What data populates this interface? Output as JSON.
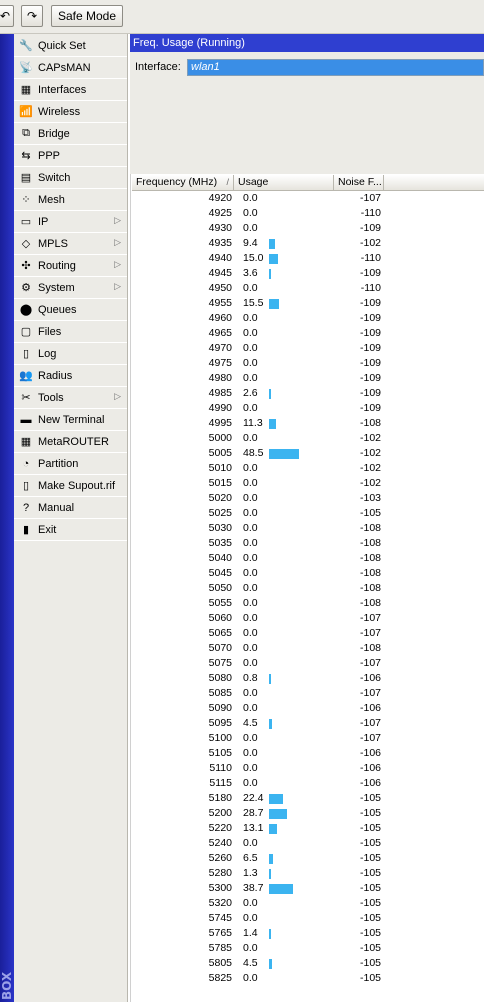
{
  "toolbar": {
    "undo_glyph": "↶",
    "redo_glyph": "↷",
    "safe_mode_label": "Safe Mode"
  },
  "brand_text": "BOX",
  "sidebar": {
    "items": [
      {
        "label": "Quick Set",
        "icon": "quick-set-icon",
        "glyph": "🔧",
        "submenu": false
      },
      {
        "label": "CAPsMAN",
        "icon": "capsman-icon",
        "glyph": "📡",
        "submenu": false
      },
      {
        "label": "Interfaces",
        "icon": "interfaces-icon",
        "glyph": "▦",
        "submenu": false
      },
      {
        "label": "Wireless",
        "icon": "wireless-icon",
        "glyph": "📶",
        "submenu": false
      },
      {
        "label": "Bridge",
        "icon": "bridge-icon",
        "glyph": "⧉",
        "submenu": false
      },
      {
        "label": "PPP",
        "icon": "ppp-icon",
        "glyph": "⇆",
        "submenu": false
      },
      {
        "label": "Switch",
        "icon": "switch-icon",
        "glyph": "▤",
        "submenu": false
      },
      {
        "label": "Mesh",
        "icon": "mesh-icon",
        "glyph": "⁘",
        "submenu": false
      },
      {
        "label": "IP",
        "icon": "ip-icon",
        "glyph": "▭",
        "submenu": true
      },
      {
        "label": "MPLS",
        "icon": "mpls-icon",
        "glyph": "◇",
        "submenu": true
      },
      {
        "label": "Routing",
        "icon": "routing-icon",
        "glyph": "✣",
        "submenu": true
      },
      {
        "label": "System",
        "icon": "system-icon",
        "glyph": "⚙",
        "submenu": true
      },
      {
        "label": "Queues",
        "icon": "queues-icon",
        "glyph": "⬤",
        "submenu": false
      },
      {
        "label": "Files",
        "icon": "files-icon",
        "glyph": "▢",
        "submenu": false
      },
      {
        "label": "Log",
        "icon": "log-icon",
        "glyph": "▯",
        "submenu": false
      },
      {
        "label": "Radius",
        "icon": "radius-icon",
        "glyph": "👥",
        "submenu": false
      },
      {
        "label": "Tools",
        "icon": "tools-icon",
        "glyph": "✂",
        "submenu": true
      },
      {
        "label": "New Terminal",
        "icon": "terminal-icon",
        "glyph": "▬",
        "submenu": false
      },
      {
        "label": "MetaROUTER",
        "icon": "metarouter-icon",
        "glyph": "▦",
        "submenu": false
      },
      {
        "label": "Partition",
        "icon": "partition-icon",
        "glyph": "◔",
        "submenu": false
      },
      {
        "label": "Make Supout.rif",
        "icon": "supout-icon",
        "glyph": "▯",
        "submenu": false
      },
      {
        "label": "Manual",
        "icon": "manual-icon",
        "glyph": "?",
        "submenu": false
      },
      {
        "label": "Exit",
        "icon": "exit-icon",
        "glyph": "▮",
        "submenu": false
      }
    ],
    "submenu_arrow": "▷"
  },
  "panel": {
    "title": "Freq. Usage (Running)",
    "interface_label": "Interface:",
    "interface_value": "wlan1"
  },
  "table": {
    "columns": [
      "Frequency (MHz)",
      "Usage",
      "Noise F..."
    ],
    "sort_glyph": "/",
    "usage_bar_color": "#3bb4f0",
    "rows": [
      {
        "freq": "4920",
        "usage": "0.0",
        "noise": "-107"
      },
      {
        "freq": "4925",
        "usage": "0.0",
        "noise": "-110"
      },
      {
        "freq": "4930",
        "usage": "0.0",
        "noise": "-109"
      },
      {
        "freq": "4935",
        "usage": "9.4",
        "noise": "-102"
      },
      {
        "freq": "4940",
        "usage": "15.0",
        "noise": "-110"
      },
      {
        "freq": "4945",
        "usage": "3.6",
        "noise": "-109"
      },
      {
        "freq": "4950",
        "usage": "0.0",
        "noise": "-110"
      },
      {
        "freq": "4955",
        "usage": "15.5",
        "noise": "-109"
      },
      {
        "freq": "4960",
        "usage": "0.0",
        "noise": "-109"
      },
      {
        "freq": "4965",
        "usage": "0.0",
        "noise": "-109"
      },
      {
        "freq": "4970",
        "usage": "0.0",
        "noise": "-109"
      },
      {
        "freq": "4975",
        "usage": "0.0",
        "noise": "-109"
      },
      {
        "freq": "4980",
        "usage": "0.0",
        "noise": "-109"
      },
      {
        "freq": "4985",
        "usage": "2.6",
        "noise": "-109"
      },
      {
        "freq": "4990",
        "usage": "0.0",
        "noise": "-109"
      },
      {
        "freq": "4995",
        "usage": "11.3",
        "noise": "-108"
      },
      {
        "freq": "5000",
        "usage": "0.0",
        "noise": "-102"
      },
      {
        "freq": "5005",
        "usage": "48.5",
        "noise": "-102"
      },
      {
        "freq": "5010",
        "usage": "0.0",
        "noise": "-102"
      },
      {
        "freq": "5015",
        "usage": "0.0",
        "noise": "-102"
      },
      {
        "freq": "5020",
        "usage": "0.0",
        "noise": "-103"
      },
      {
        "freq": "5025",
        "usage": "0.0",
        "noise": "-105"
      },
      {
        "freq": "5030",
        "usage": "0.0",
        "noise": "-108"
      },
      {
        "freq": "5035",
        "usage": "0.0",
        "noise": "-108"
      },
      {
        "freq": "5040",
        "usage": "0.0",
        "noise": "-108"
      },
      {
        "freq": "5045",
        "usage": "0.0",
        "noise": "-108"
      },
      {
        "freq": "5050",
        "usage": "0.0",
        "noise": "-108"
      },
      {
        "freq": "5055",
        "usage": "0.0",
        "noise": "-108"
      },
      {
        "freq": "5060",
        "usage": "0.0",
        "noise": "-107"
      },
      {
        "freq": "5065",
        "usage": "0.0",
        "noise": "-107"
      },
      {
        "freq": "5070",
        "usage": "0.0",
        "noise": "-108"
      },
      {
        "freq": "5075",
        "usage": "0.0",
        "noise": "-107"
      },
      {
        "freq": "5080",
        "usage": "0.8",
        "noise": "-106"
      },
      {
        "freq": "5085",
        "usage": "0.0",
        "noise": "-107"
      },
      {
        "freq": "5090",
        "usage": "0.0",
        "noise": "-106"
      },
      {
        "freq": "5095",
        "usage": "4.5",
        "noise": "-107"
      },
      {
        "freq": "5100",
        "usage": "0.0",
        "noise": "-107"
      },
      {
        "freq": "5105",
        "usage": "0.0",
        "noise": "-106"
      },
      {
        "freq": "5110",
        "usage": "0.0",
        "noise": "-106"
      },
      {
        "freq": "5115",
        "usage": "0.0",
        "noise": "-106"
      },
      {
        "freq": "5180",
        "usage": "22.4",
        "noise": "-105"
      },
      {
        "freq": "5200",
        "usage": "28.7",
        "noise": "-105"
      },
      {
        "freq": "5220",
        "usage": "13.1",
        "noise": "-105"
      },
      {
        "freq": "5240",
        "usage": "0.0",
        "noise": "-105"
      },
      {
        "freq": "5260",
        "usage": "6.5",
        "noise": "-105"
      },
      {
        "freq": "5280",
        "usage": "1.3",
        "noise": "-105"
      },
      {
        "freq": "5300",
        "usage": "38.7",
        "noise": "-105"
      },
      {
        "freq": "5320",
        "usage": "0.0",
        "noise": "-105"
      },
      {
        "freq": "5745",
        "usage": "0.0",
        "noise": "-105"
      },
      {
        "freq": "5765",
        "usage": "1.4",
        "noise": "-105"
      },
      {
        "freq": "5785",
        "usage": "0.0",
        "noise": "-105"
      },
      {
        "freq": "5805",
        "usage": "4.5",
        "noise": "-105"
      },
      {
        "freq": "5825",
        "usage": "0.0",
        "noise": "-105"
      }
    ]
  }
}
